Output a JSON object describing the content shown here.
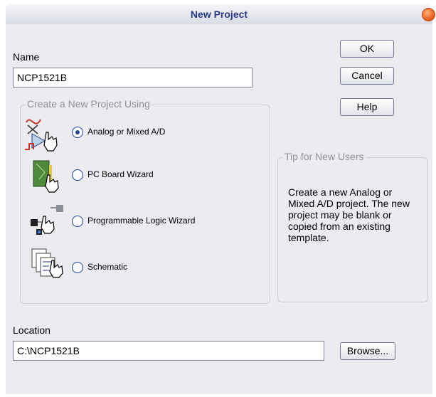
{
  "window": {
    "title": "New Project"
  },
  "name_field": {
    "label": "Name",
    "value": "NCP1521B"
  },
  "buttons": {
    "ok": "OK",
    "cancel": "Cancel",
    "help": "Help",
    "browse": "Browse..."
  },
  "project_group": {
    "title": "Create a New Project Using",
    "options": [
      {
        "label": "Analog or Mixed A/D",
        "selected": true,
        "icon": "analog-circuit-icon"
      },
      {
        "label": "PC Board Wizard",
        "selected": false,
        "icon": "pcb-icon"
      },
      {
        "label": "Programmable Logic Wizard",
        "selected": false,
        "icon": "logic-chip-icon"
      },
      {
        "label": "Schematic",
        "selected": false,
        "icon": "schematic-pages-icon"
      }
    ]
  },
  "tip": {
    "title": "Tip for New Users",
    "text": "Create a new Analog or Mixed A/D project.  The new project may be blank or copied from an existing template."
  },
  "location_field": {
    "label": "Location",
    "value": "C:\\NCP1521B"
  },
  "colors": {
    "accent": "#2a3a80",
    "dialog_bg": "#ebebf0",
    "close": "#e4571c"
  }
}
